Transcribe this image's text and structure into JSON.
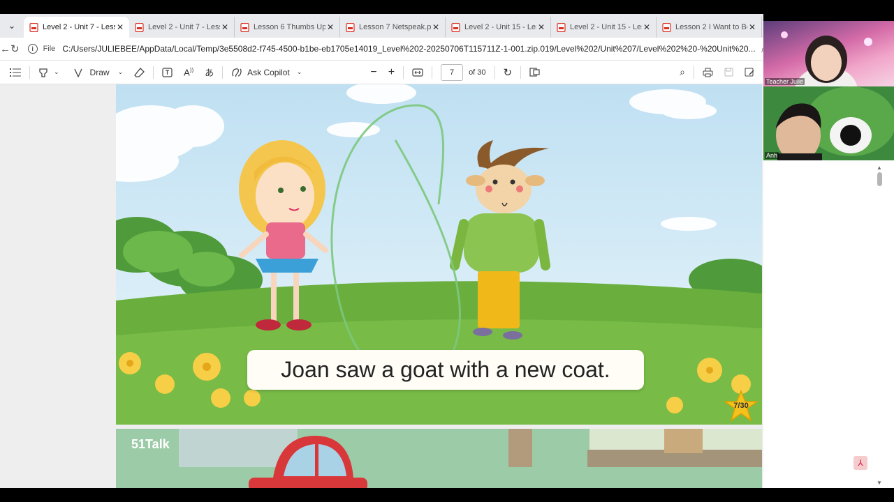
{
  "tabs": [
    {
      "label": "Level 2 - Unit 7 - Lesson",
      "active": true
    },
    {
      "label": "Level 2 - Unit 7 - Lesso",
      "active": false
    },
    {
      "label": "Lesson 6 Thumbs Up.p",
      "active": false
    },
    {
      "label": "Lesson 7 Netspeak.pdf",
      "active": false
    },
    {
      "label": "Level 2 - Unit 15 - Less",
      "active": false
    },
    {
      "label": "Level 2 - Unit 15 - Less",
      "active": false
    },
    {
      "label": "Lesson 2 I Want to Be a",
      "active": false
    }
  ],
  "address": {
    "scheme": "File",
    "url": "C:/Users/JULIEBEE/AppData/Local/Temp/3e5508d2-f745-4500-b1be-eb1705e14019_Level%202-20250706T115711Z-1-001.zip.019/Level%202/Unit%207/Level%202%20-%20Unit%20..."
  },
  "pdf_toolbar": {
    "draw_label": "Draw",
    "copilot_label": "Ask Copilot",
    "page_current": "7",
    "page_total_label": "of 30"
  },
  "slide": {
    "caption": "Joan saw a goat with a new coat.",
    "page_badge": "7/30"
  },
  "slide2": {
    "logo": "51Talk"
  },
  "video": {
    "tile1_name": "Teacher Julie",
    "tile2_name": "Anh"
  },
  "colors": {
    "accent": "#1a73e8",
    "pdf_red": "#d93025",
    "sky": "#cfe6f4",
    "grass": "#6aa84f"
  }
}
